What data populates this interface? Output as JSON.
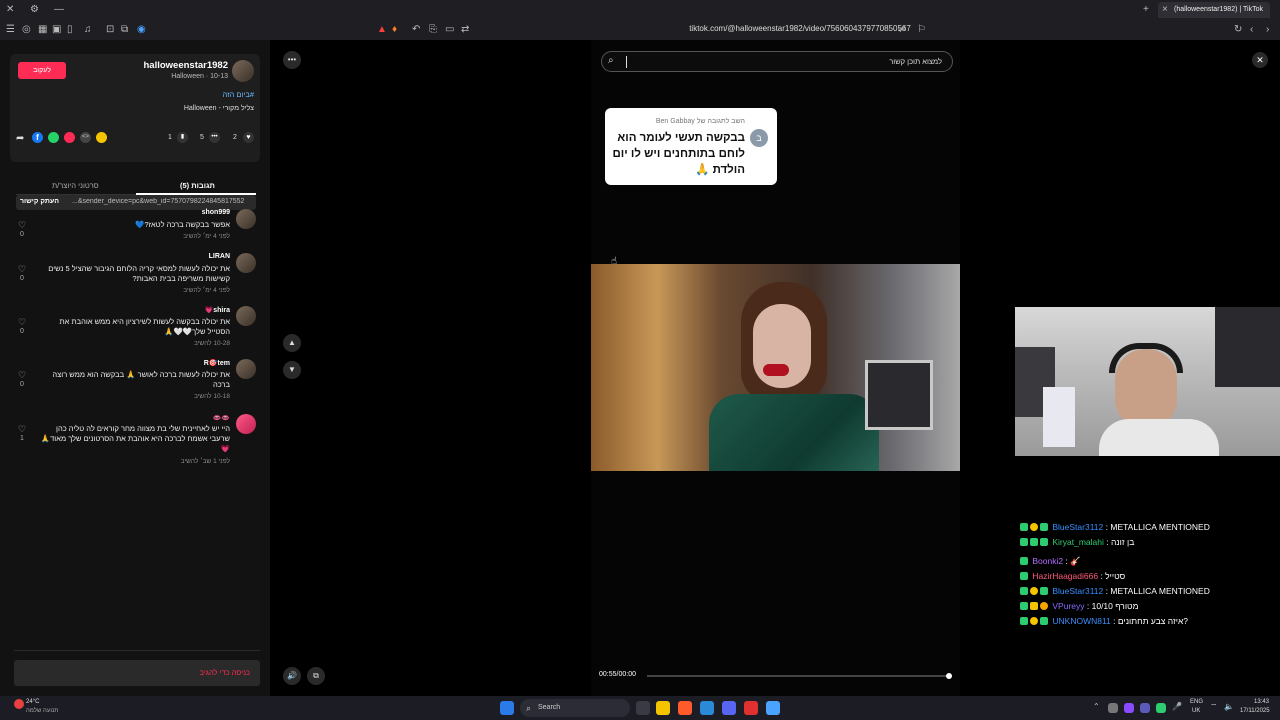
{
  "browser": {
    "url": "tiktok.com/@halloweenstar1982/video/7560604379770850567",
    "tab_title": "(halloweenstar1982) | TikTok",
    "new_tab": "+",
    "close_tab": "×"
  },
  "profile": {
    "username": "halloweenstar1982",
    "subtitle": "Halloween · 10-13",
    "follow_label": "לעקוב",
    "hashtag": "#ביום הזה",
    "sound": "צליל מקורי - Halloween",
    "more": "•••"
  },
  "stats": {
    "likes": "2",
    "comments": "5",
    "saves": "1"
  },
  "share": {
    "copy_label": "העתק קישור",
    "link_text": "...&sender_device=pc&web_id=7570798224845817552"
  },
  "tabs": {
    "comments": "תגובות (5)",
    "creator_videos": "סרטוני היוצר/ת"
  },
  "comments": [
    {
      "user": "shon999",
      "text": "אפשר בבקשה ברכה לטאז?💙",
      "meta": "לפני 4 ימ׳   להשיב",
      "likes": "0"
    },
    {
      "user": "LIRAN",
      "text": "את יכולה לעשות למסאי קריה הלוחם הגיבור שהציל 5 נשים קשישות משריפה בבית האבות?",
      "meta": "לפני 4 ימ׳   להשיב",
      "likes": "0"
    },
    {
      "user": "shira💗",
      "text": "את יכולה בבקשה לעשות לשירציון היא ממש אוהבת את הסטייל שלך🤍🤍🙏",
      "meta": "10-28   להשיב",
      "likes": "0"
    },
    {
      "user": "R🎯tem",
      "text": "את יכולה לעשות ברכה לאושר 🙏 בבקשה הוא ממש רוצה ברכה",
      "meta": "10-18   להשיב",
      "likes": "0"
    },
    {
      "user": "👄👄",
      "text": "היי יש לאחיינית שלי בת מצווה מחר קוראים לה טליה כהן שרעבי אשמח לברכה היא אוהבת את הסרטונים שלך מאוד🙏💗",
      "meta": "לפני 1 שב׳   להשיב",
      "likes": "1"
    }
  ],
  "reply_placeholder": "כניסה כדי להגיב",
  "video": {
    "search_placeholder": "למצוא תוכן קשור",
    "bubble_header": "השב לתגובה של Ben Gabbay",
    "bubble_avatar": "ב",
    "bubble_text": "בבקשה תעשי לעומר הוא לוחם בתותחנים ויש לו יום הולדת 🙏",
    "time": "00:55/00:00",
    "close": "✕"
  },
  "chat": [
    {
      "user": "BlueStar3112",
      "user_color": "#3b8eff",
      "message": ": METALLICA MENTIONED"
    },
    {
      "user": "Kiryat_malahi",
      "user_color": "#2ecc71",
      "message": ": בן זונה"
    },
    {
      "user": "Boonki2",
      "user_color": "#b36bff",
      "message": ": 🎸"
    },
    {
      "user": "HazirHaagadi666",
      "user_color": "#ff5a7a",
      "message": ": סטייל"
    },
    {
      "user": "BlueStar3112",
      "user_color": "#3b8eff",
      "message": ": METALLICA MENTIONED"
    },
    {
      "user": "VPureyy",
      "user_color": "#8a6bff",
      "message": ": מטורף 10/10"
    },
    {
      "user": "UNKNOWN811",
      "user_color": "#3b8eff",
      "message": ": איזה צבע תחתונים?"
    }
  ],
  "taskbar": {
    "weather_temp": "24°C",
    "weather_desc": "תנועה שלמה",
    "search": "Search",
    "lang": "ENG",
    "region": "UK",
    "time": "13:43",
    "date": "17/11/2025"
  },
  "colors": {
    "accent": "#fe2c55",
    "panel": "#121212"
  }
}
